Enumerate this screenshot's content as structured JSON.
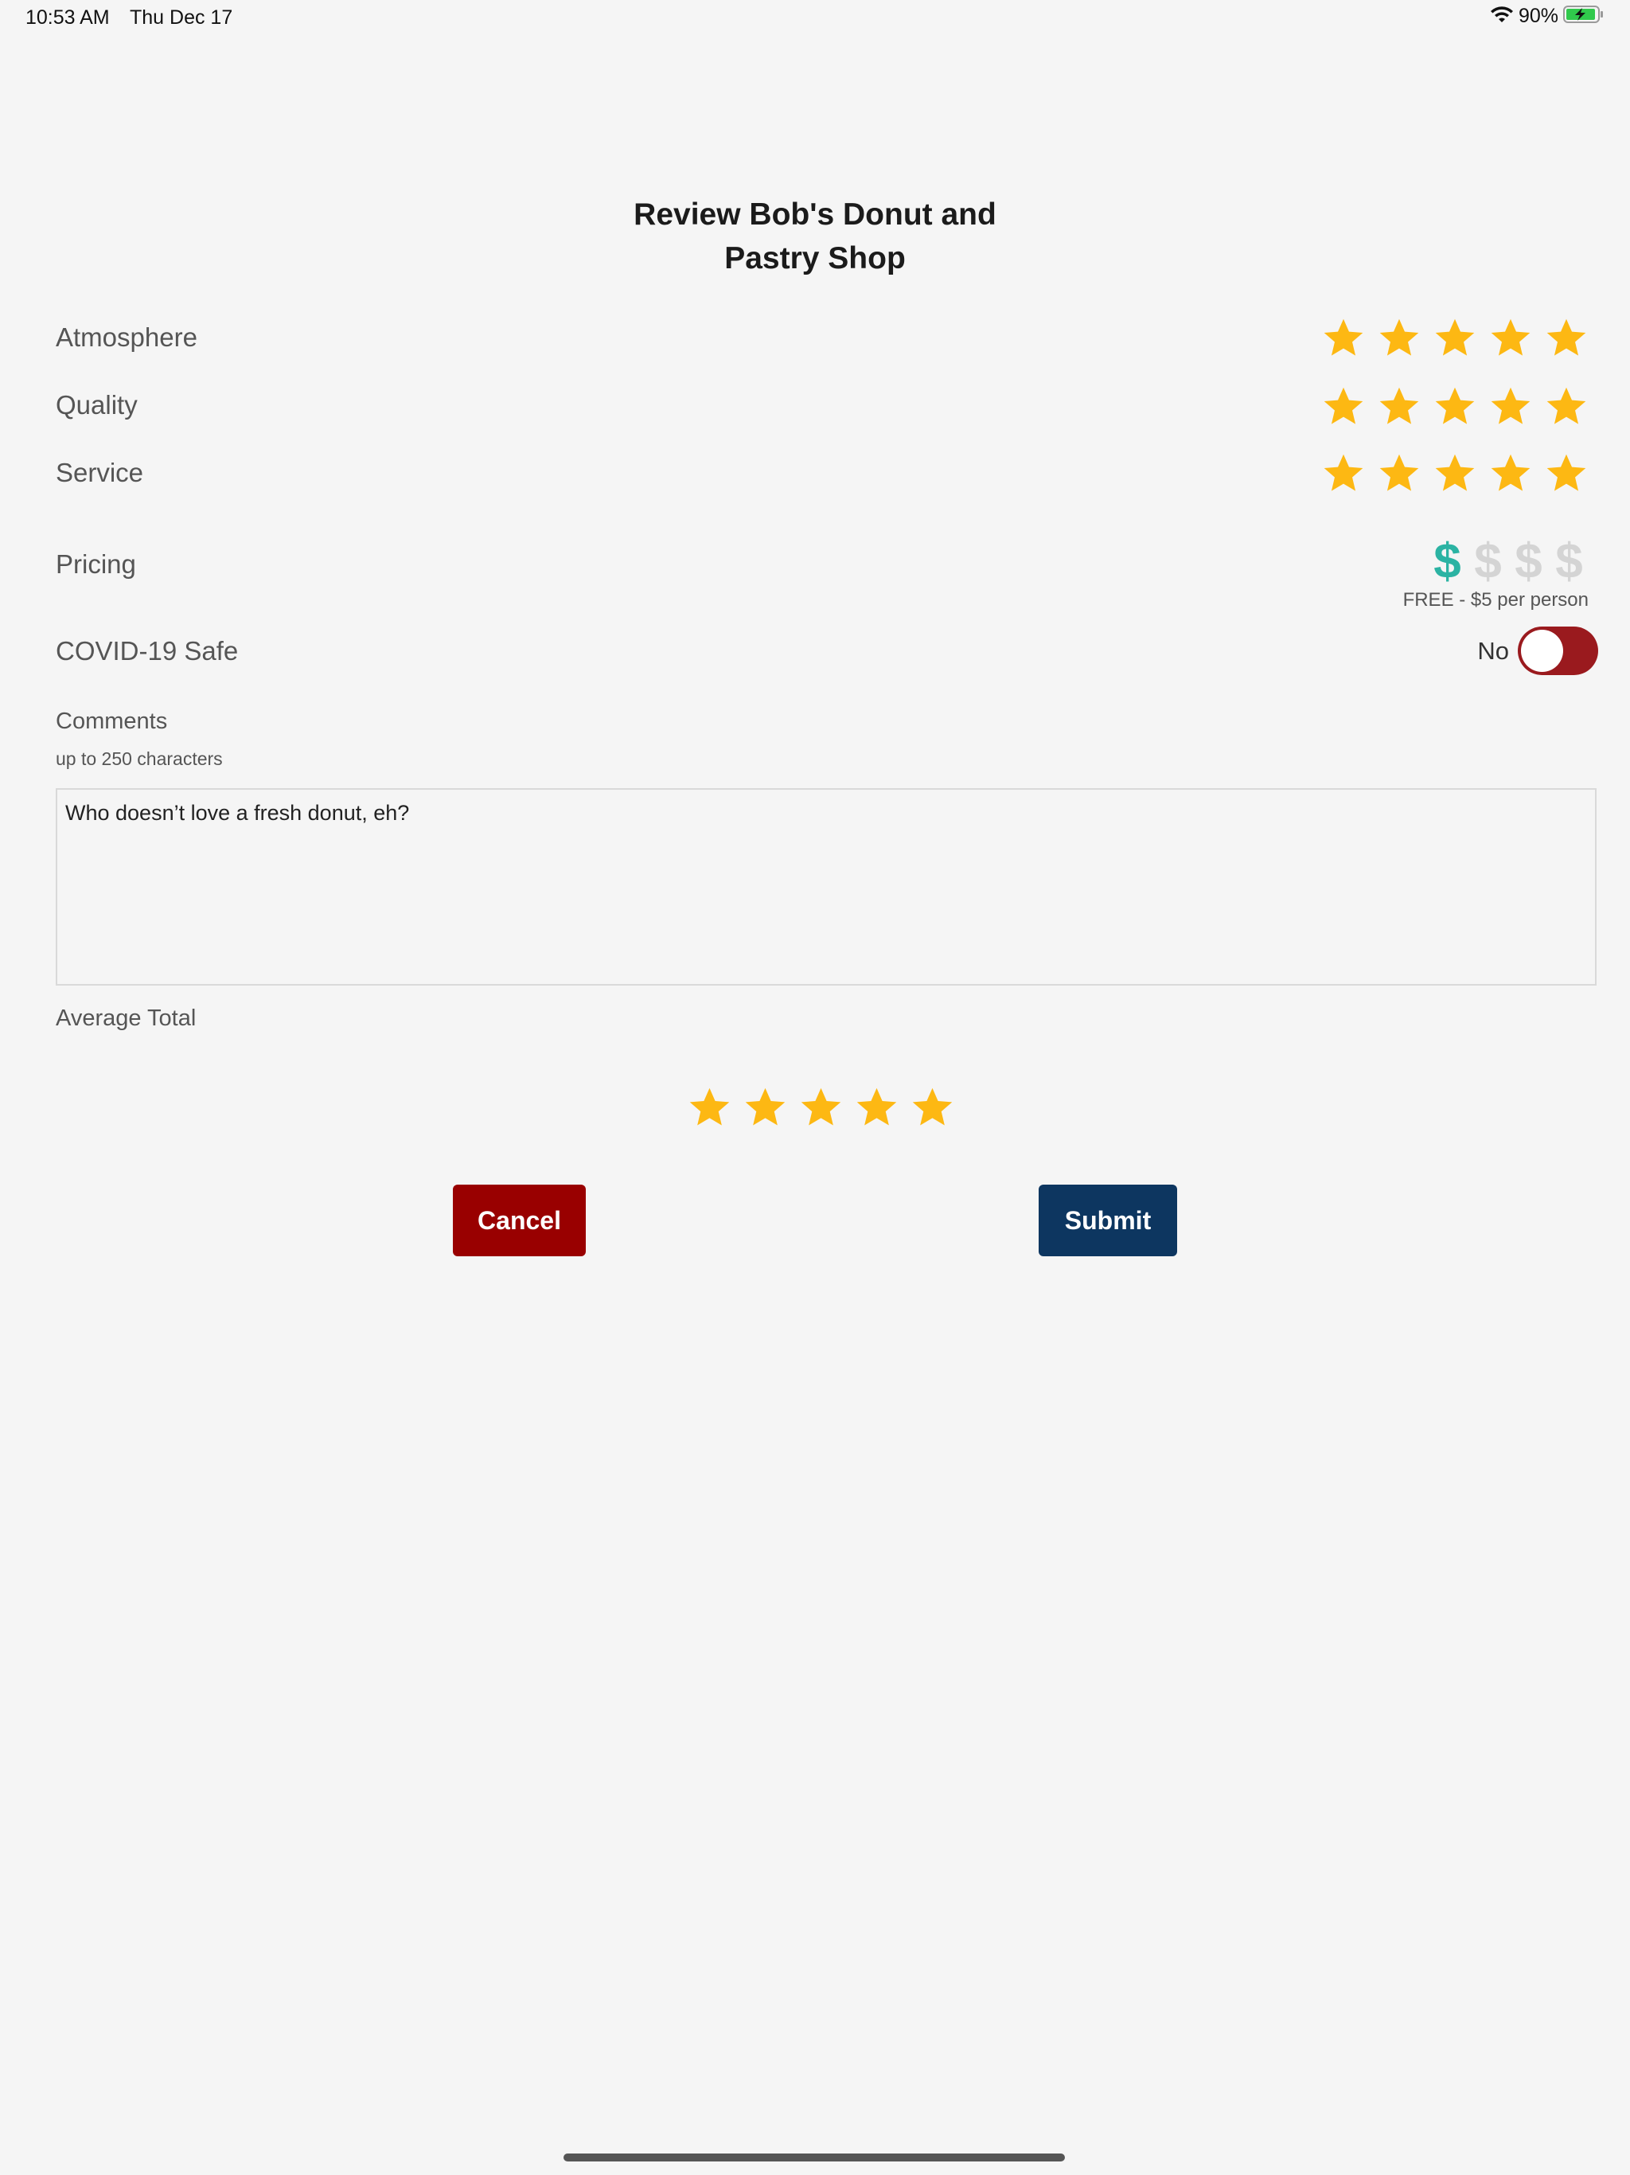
{
  "status_bar": {
    "time": "10:53 AM",
    "date": "Thu Dec 17",
    "battery_percent": "90%",
    "icons": [
      "wifi-icon",
      "battery-charging-icon"
    ]
  },
  "page": {
    "title_line1": "Review Bob's Donut and",
    "title_line2": "Pastry Shop"
  },
  "ratings": {
    "atmosphere": {
      "label": "Atmosphere",
      "stars": 5,
      "max": 5
    },
    "quality": {
      "label": "Quality",
      "stars": 5,
      "max": 5
    },
    "service": {
      "label": "Service",
      "stars": 5,
      "max": 5
    }
  },
  "pricing": {
    "label": "Pricing",
    "level": 1,
    "max": 4,
    "symbol": "$",
    "note": "FREE - $5 per person"
  },
  "covid": {
    "label": "COVID-19 Safe",
    "state_label": "No",
    "on": false
  },
  "comments": {
    "label": "Comments",
    "hint": "up to 250 characters",
    "value": "Who doesn’t love a fresh donut, eh?"
  },
  "average": {
    "label": "Average Total",
    "stars": 5,
    "max": 5
  },
  "actions": {
    "cancel_label": "Cancel",
    "submit_label": "Submit"
  },
  "colors": {
    "background": "#f5f5f5",
    "star": "#FDB813",
    "price_active": "#2bb3a3",
    "price_inactive": "#d4d4d4",
    "toggle_track": "#9a1a1e",
    "cancel": "#990000",
    "submit": "#0d3660"
  }
}
